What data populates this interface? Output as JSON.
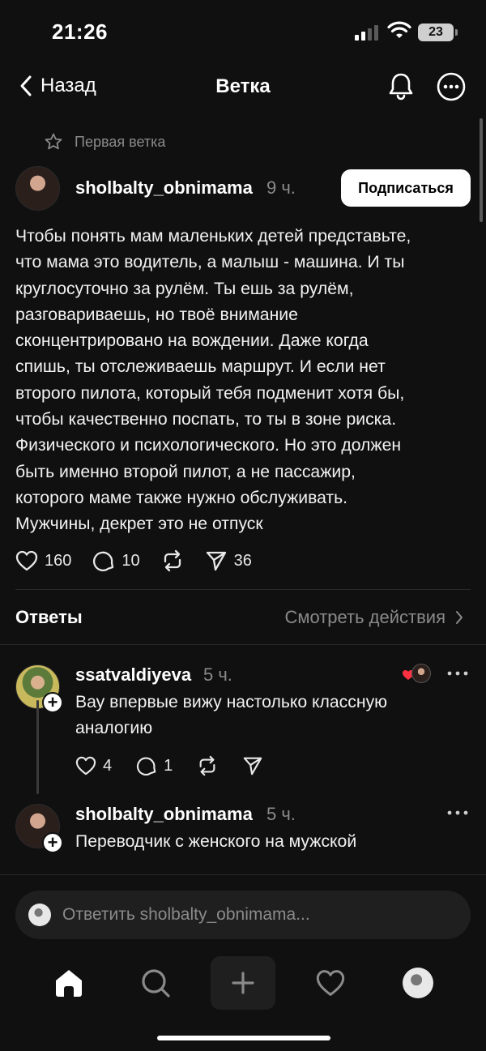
{
  "status_bar": {
    "time": "21:26",
    "battery": "23"
  },
  "header": {
    "back_label": "Назад",
    "title": "Ветка"
  },
  "thread_label": "Первая ветка",
  "post": {
    "author": "sholbalty_obnimama",
    "time": "9 ч.",
    "follow_label": "Подписаться",
    "text": "Чтобы понять мам маленьких детей представьте,\nчто мама это водитель, а малыш - машина. И ты\nкруглосуточно за рулём. Ты ешь за рулём,\nразговариваешь, но твоё внимание\nсконцентрировано на вождении. Даже когда\nспишь, ты отслеживаешь маршрут. И если нет\nвторого пилота, который тебя подменит хотя бы,\nчтобы качественно поспать, то ты в зоне риска.\nФизического и психологического. Но это должен\nбыть именно второй пилот, а не пассажир,\nкоторого маме также нужно обслуживать.\nМужчины, декрет это не отпуск",
    "likes": "160",
    "comments": "10",
    "shares": "36"
  },
  "replies_section": {
    "title": "Ответы",
    "view_activity": "Смотреть действия"
  },
  "replies": [
    {
      "author": "ssatvaldiyeva",
      "time": "5 ч.",
      "text": "Вау впервые вижу настолько классную аналогию",
      "likes": "4",
      "comments": "1"
    },
    {
      "author": "sholbalty_obnimama",
      "time": "5 ч.",
      "text": "Переводчик с женского на мужской"
    }
  ],
  "composer": {
    "placeholder": "Ответить sholbalty_obnimama..."
  },
  "colors": {
    "background": "#101010",
    "muted": "#8a8a8a",
    "like_red": "#ff3040"
  }
}
